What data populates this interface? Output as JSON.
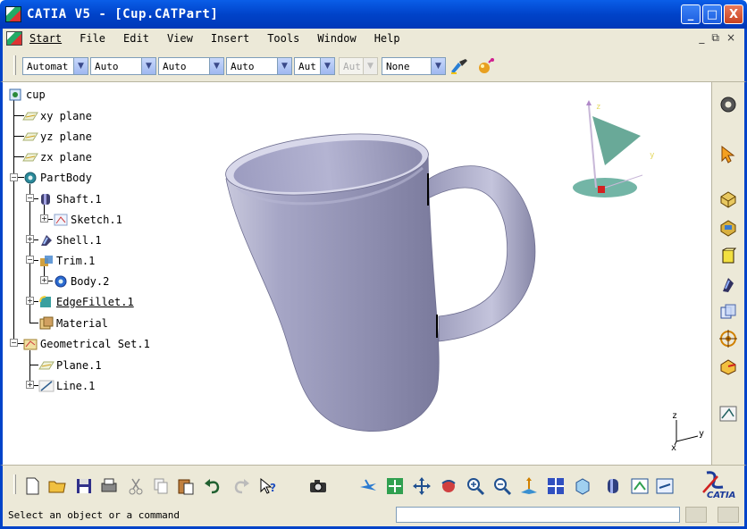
{
  "window": {
    "title": "CATIA V5 - [Cup.CATPart]",
    "buttons": {
      "minimize": "_",
      "maximize": "□",
      "close": "X"
    }
  },
  "menu": {
    "items": [
      {
        "label": "Start"
      },
      {
        "label": "File"
      },
      {
        "label": "Edit"
      },
      {
        "label": "View"
      },
      {
        "label": "Insert"
      },
      {
        "label": "Tools"
      },
      {
        "label": "Window"
      },
      {
        "label": "Help"
      }
    ],
    "mdi": {
      "minimize": "_",
      "restore": "⧉",
      "close": "×"
    }
  },
  "properties_toolbar": {
    "combos": [
      {
        "value": "Automat"
      },
      {
        "value": "Auto"
      },
      {
        "value": "Auto"
      },
      {
        "value": "Auto"
      },
      {
        "value": "Aut"
      },
      {
        "value": "Aut",
        "disabled": true
      },
      {
        "value": "None"
      }
    ]
  },
  "tree": {
    "items": [
      {
        "label": "cup"
      },
      {
        "label": "xy plane"
      },
      {
        "label": "yz plane"
      },
      {
        "label": "zx plane"
      },
      {
        "label": "PartBody"
      },
      {
        "label": "Shaft.1"
      },
      {
        "label": "Sketch.1"
      },
      {
        "label": "Shell.1"
      },
      {
        "label": "Trim.1"
      },
      {
        "label": "Body.2"
      },
      {
        "label": "EdgeFillet.1"
      },
      {
        "label": "Material"
      },
      {
        "label": "Geometrical Set.1"
      },
      {
        "label": "Plane.1"
      },
      {
        "label": "Line.1"
      }
    ]
  },
  "compass": {
    "z": "z",
    "y": "y"
  },
  "axis_triad": {
    "z": "z",
    "y": "y",
    "x": "x"
  },
  "logo": {
    "text": "CATIA"
  },
  "status": {
    "message": "Select an object or a command",
    "command_input": ""
  },
  "colors": {
    "titlebar": "#0043c9",
    "chrome": "#ece9d8",
    "cup_body": "#a0a0c0"
  }
}
